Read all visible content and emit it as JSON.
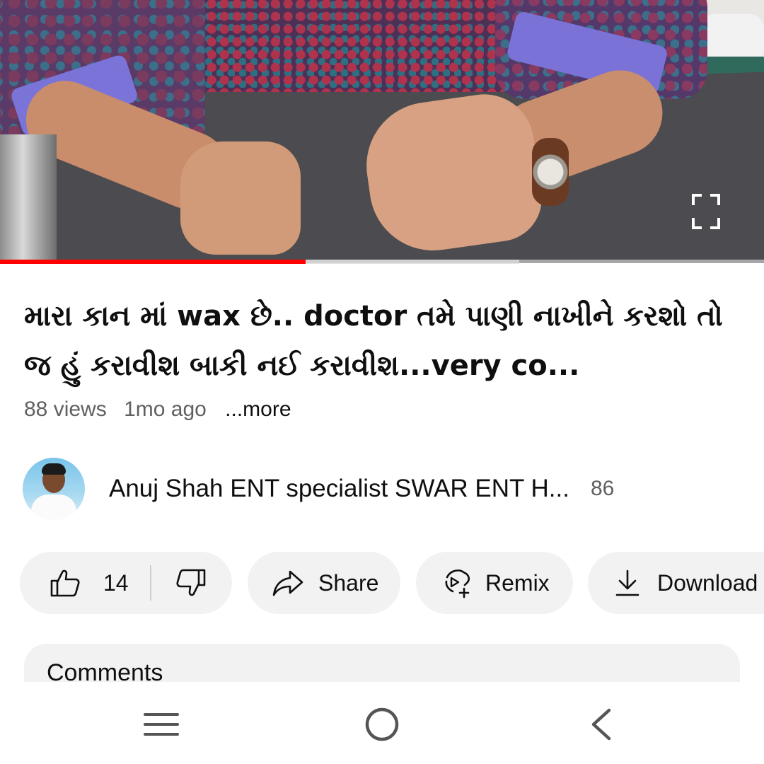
{
  "video": {
    "title": "મારા કાન માં wax છે.. doctor તમે પાણી નાખીને કરશો તો જ હું કરાવીશ બાકી નઈ કરાવીશ...very co...",
    "views": "88 views",
    "age": "1mo ago",
    "more_label": "...more",
    "progress_fraction": 0.4,
    "buffered_fraction": 0.68
  },
  "channel": {
    "name": "Anuj Shah ENT specialist SWAR ENT H...",
    "subscriber_count": "86"
  },
  "actions": {
    "like_count": "14",
    "share_label": "Share",
    "remix_label": "Remix",
    "download_label": "Download"
  },
  "comments": {
    "heading": "Comments"
  },
  "icons": {
    "fullscreen": "fullscreen-icon",
    "like": "thumbs-up-icon",
    "dislike": "thumbs-down-icon",
    "share": "share-arrow-icon",
    "remix": "remix-icon",
    "download": "download-icon",
    "nav_menu": "recent-apps-icon",
    "nav_home": "home-circle-icon",
    "nav_back": "back-chevron-icon"
  },
  "colors": {
    "progress_played": "#ff0000",
    "chip_background": "#f2f2f2",
    "secondary_text": "#606060",
    "primary_text": "#0f0f0f"
  }
}
